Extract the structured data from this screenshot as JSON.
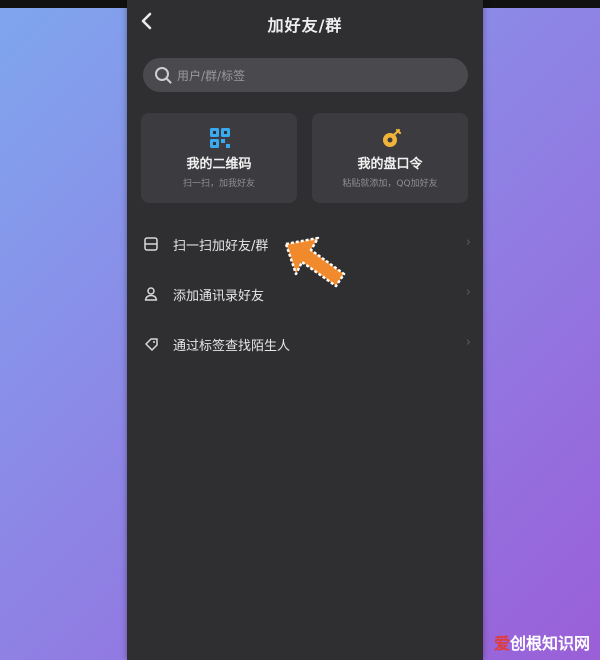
{
  "header": {
    "title": "加好友/群"
  },
  "search": {
    "placeholder": "用户/群/标签"
  },
  "cards": [
    {
      "title": "我的二维码",
      "subtitle": "扫一扫，加我好友",
      "icon": "qr-code-icon"
    },
    {
      "title": "我的盘口令",
      "subtitle": "粘贴就添加，QQ加好友",
      "icon": "password-key-icon"
    }
  ],
  "menu": [
    {
      "label": "扫一扫加好友/群",
      "icon": "scan-icon"
    },
    {
      "label": "添加通讯录好友",
      "icon": "contacts-person-icon"
    },
    {
      "label": "通过标签查找陌生人",
      "icon": "tag-icon"
    }
  ],
  "watermark": {
    "red": "爱",
    "white": "创根知识网"
  },
  "colors": {
    "phone_bg": "#2f2f32",
    "card_bg": "#3c3c40",
    "arrow": "#f08a2c",
    "qr_blue": "#3aa9f0",
    "key_yellow": "#f0b43a"
  }
}
